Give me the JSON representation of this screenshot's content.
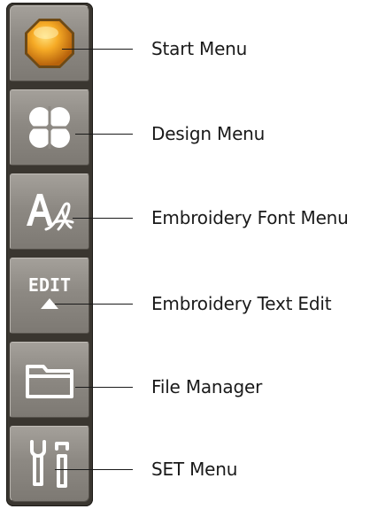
{
  "toolbar": {
    "buttons": [
      {
        "icon": "start-orb-icon",
        "label": "Start Menu"
      },
      {
        "icon": "design-clover-icon",
        "label": "Design Menu"
      },
      {
        "icon": "embroidery-font-icon",
        "label": "Embroidery Font Menu"
      },
      {
        "icon": "edit-arrow-icon",
        "label": "Embroidery Text Edit",
        "icon_text": "EDIT"
      },
      {
        "icon": "folder-icon",
        "label": "File Manager"
      },
      {
        "icon": "settings-tools-icon",
        "label": "SET Menu"
      }
    ]
  },
  "colors": {
    "panel": "#3a3630",
    "button": "#8d8983",
    "icon": "#ffffff",
    "orb": "#f3a623",
    "text": "#1a1a1a"
  }
}
